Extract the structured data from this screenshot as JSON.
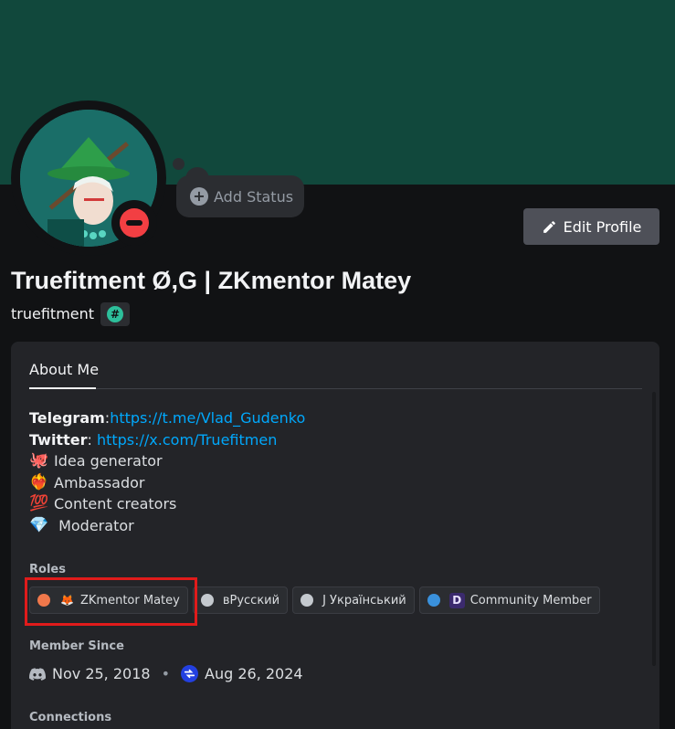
{
  "profile": {
    "display_name": "Truefitment Ø,G | ZKmentor Matey",
    "username": "truefitment",
    "add_status_label": "Add Status",
    "edit_profile_label": "Edit Profile",
    "badge_symbol": "#"
  },
  "tabs": {
    "about_me": "About Me"
  },
  "bio": {
    "telegram_label": "Telegram",
    "telegram_sep": ":",
    "telegram_url": "https://t.me/Vlad_Gudenko",
    "twitter_label": "Twitter",
    "twitter_sep": ": ",
    "twitter_url": "https://x.com/Truefitmen",
    "lines": [
      {
        "emoji": "octopus-icon",
        "glyph": "🐙",
        "text": "Idea generator"
      },
      {
        "emoji": "fire-heart-icon",
        "glyph": "❤️‍🔥",
        "text": "Ambassador"
      },
      {
        "emoji": "hundred-icon",
        "glyph": "💯",
        "text": "Content creators"
      },
      {
        "emoji": "gem-icon",
        "glyph": "💎",
        "text": " Moderator"
      }
    ]
  },
  "roles_heading": "Roles",
  "roles": [
    {
      "label": "ZKmentor Matey",
      "color": "#f0784b",
      "icon": "fox-icon",
      "glyph": "🦊"
    },
    {
      "label": "вРусский",
      "color": "#c4c9ce"
    },
    {
      "label": "Ј Український",
      "color": "#c4c9ce"
    },
    {
      "label": "Community Member",
      "color": "#3a91dc",
      "icon": "community-icon",
      "glyph": "D"
    }
  ],
  "member_since_heading": "Member Since",
  "member_since": {
    "discord_date": "Nov 25, 2018",
    "separator": "•",
    "server_date": "Aug 26, 2024"
  },
  "connections_heading": "Connections",
  "colors": {
    "banner": "#11483c",
    "accent": "#00a8fc",
    "dnd": "#f23f43",
    "highlight": "#e01b1b"
  }
}
